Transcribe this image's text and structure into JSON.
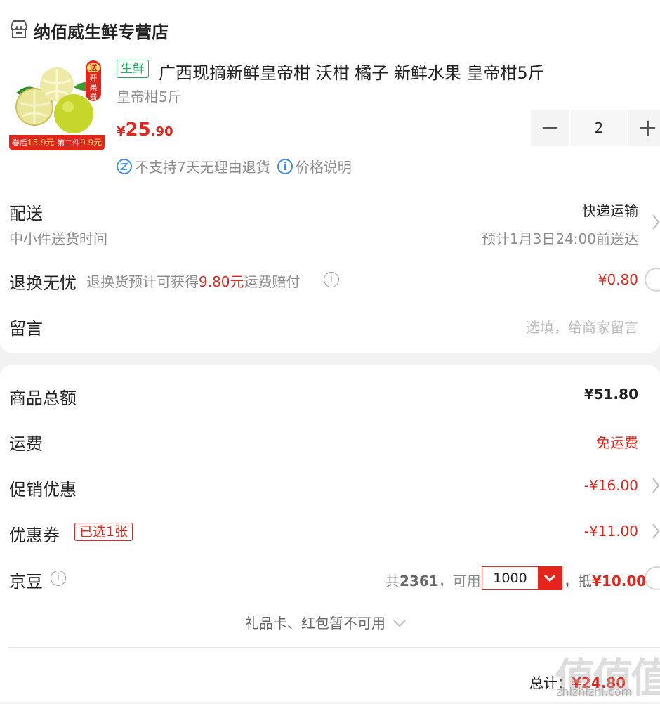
{
  "store": {
    "name": "纳佰威生鲜专营店",
    "icon": "store-icon"
  },
  "product": {
    "tag": "生鲜",
    "title": "广西现摘新鲜皇帝柑 沃柑 橘子 新鲜水果 皇帝柑5斤",
    "spec": "皇帝柑5斤",
    "price_symbol": "¥",
    "price_int": "25",
    "price_dec": ".90",
    "image_badge_top": "送",
    "image_badge_text": "开果器",
    "image_banner_1": "卷后",
    "image_banner_2": "15.9元",
    "image_banner_3": "第二件",
    "image_banner_4": "9.9元",
    "quantity": "2",
    "minus_label": "−",
    "plus_label": "+",
    "no_return": "不支持7天无理由退货",
    "price_note": "价格说明"
  },
  "delivery": {
    "label": "配送",
    "method": "快递运输",
    "sub_label": "中小件送货时间",
    "eta": "预计1月3日24:00前送达"
  },
  "return_worry_free": {
    "label": "退换无忧",
    "desc_prefix": "退换货预计可获得",
    "desc_amount": "9.80元",
    "desc_suffix": "运费赔付",
    "price": "¥0.80"
  },
  "message": {
    "label": "留言",
    "placeholder": "选填，给商家留言"
  },
  "summary": {
    "total_label": "商品总额",
    "total_value": "¥51.80",
    "shipping_label": "运费",
    "shipping_value": "免运费",
    "promo_label": "促销优惠",
    "promo_value": "-¥16.00",
    "coupon_label": "优惠券",
    "coupon_tag": "已选1张",
    "coupon_value": "-¥11.00",
    "beans_label": "京豆",
    "beans_total_prefix": "共",
    "beans_total": "2361",
    "beans_usable": "，可用",
    "beans_selected": "1000",
    "beans_deduct_prefix": "，抵",
    "beans_deduct_value": "¥10.00",
    "giftcard_note": "礼品卡、红包暂不可用"
  },
  "footer": {
    "total_label": "总计：",
    "total_value": "¥24.80"
  },
  "watermark": {
    "big": "值值值",
    "small": "zhizhizhi.com"
  },
  "colors": {
    "accent": "#e4251b",
    "fresh_green": "#1fae5b",
    "info_blue": "#3d8ef0"
  }
}
